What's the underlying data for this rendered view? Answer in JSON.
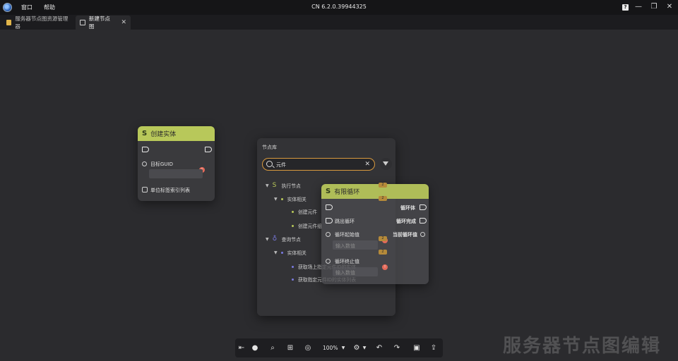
{
  "titlebar": {
    "menus": [
      "窗口",
      "帮助"
    ],
    "title": "CN 6.2.0.39944325",
    "help": "?"
  },
  "tabs": [
    {
      "label": "服务器节点图资源管理器"
    },
    {
      "label": "新建节点图",
      "close": "✕"
    }
  ],
  "node_create_entity": {
    "title": "创建实体",
    "pin_target_guid": "目标GUID",
    "pin_tag_list": "单位标签索引列表",
    "error_badge": "!"
  },
  "library": {
    "title": "节点库",
    "search_value": "元件",
    "clear": "✕",
    "tree": [
      {
        "label": "执行节点",
        "badge": "2"
      },
      {
        "label": "实体相关",
        "badge": "2"
      },
      {
        "label": "创建元件"
      },
      {
        "label": "创建元件组"
      },
      {
        "label": "查询节点",
        "badge": "2"
      },
      {
        "label": "实体相关",
        "badge": "2"
      },
      {
        "label": "获取场上指定元件ID的实体"
      },
      {
        "label": "获取指定元件ID的实体列表"
      }
    ]
  },
  "node_loop": {
    "title": "有限循环",
    "out_loop_body": "循环体",
    "out_loop_done": "循环完成",
    "out_current": "当前循环值",
    "in_break": "跳出循环",
    "in_start": "循环起始值",
    "in_start_placeholder": "输入数值",
    "in_end": "循环终止值",
    "in_end_placeholder": "输入数值",
    "error_badge": "!"
  },
  "toolbar": {
    "zoom": "100%"
  },
  "watermark": "服务器节点图编辑",
  "colors": {
    "node_header": "#b8c85a",
    "search_border": "#d99a3e",
    "error": "#e46a5a"
  }
}
